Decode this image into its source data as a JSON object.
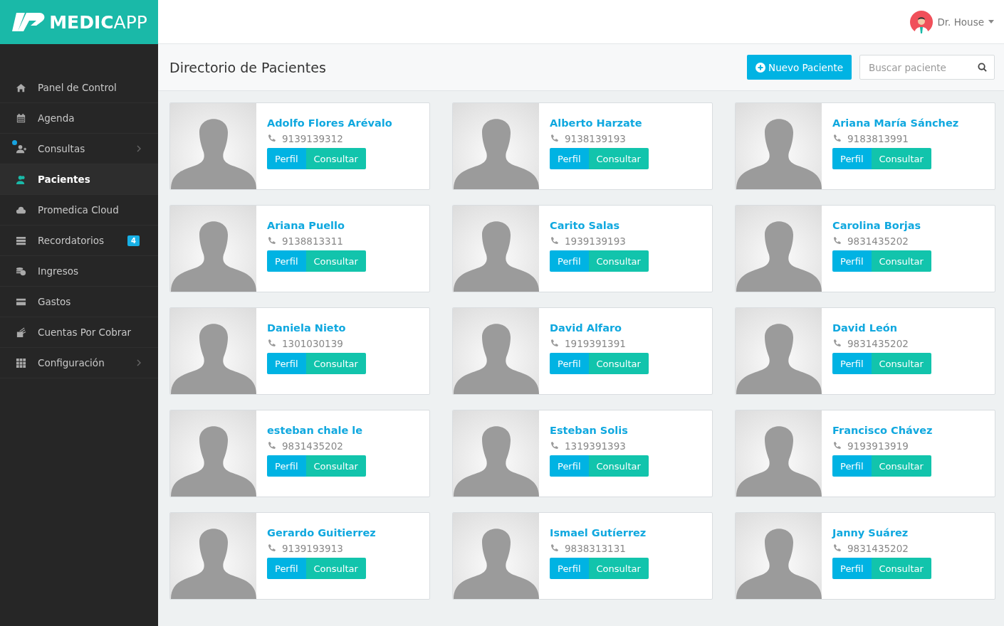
{
  "logo": {
    "bold": "MEDIC",
    "light": "APP"
  },
  "user": {
    "name": "Dr. House"
  },
  "sidebar": {
    "items": [
      {
        "label": "Panel de Control",
        "selected": false
      },
      {
        "label": "Agenda",
        "selected": false
      },
      {
        "label": "Consultas",
        "selected": false,
        "submenu": true,
        "dot": true
      },
      {
        "label": "Pacientes",
        "selected": true
      },
      {
        "label": "Promedica Cloud",
        "selected": false
      },
      {
        "label": "Recordatorios",
        "selected": false,
        "badge": "4"
      },
      {
        "label": "Ingresos",
        "selected": false
      },
      {
        "label": "Gastos",
        "selected": false
      },
      {
        "label": "Cuentas Por Cobrar",
        "selected": false
      },
      {
        "label": "Configuración",
        "selected": false,
        "submenu": true
      }
    ]
  },
  "page": {
    "title": "Directorio de Pacientes",
    "new_button": "Nuevo Paciente",
    "search": {
      "placeholder": "Buscar paciente"
    }
  },
  "patients": [
    {
      "name": "Adolfo Flores Arévalo",
      "phone": "9139139312",
      "profile": "Perfil",
      "consult": "Consultar"
    },
    {
      "name": "Alberto Harzate",
      "phone": "9138139193",
      "profile": "Perfil",
      "consult": "Consultar"
    },
    {
      "name": "Ariana María Sánchez",
      "phone": "9183813991",
      "profile": "Perfil",
      "consult": "Consultar"
    },
    {
      "name": "Ariana Puello",
      "phone": "9138813311",
      "profile": "Perfil",
      "consult": "Consultar"
    },
    {
      "name": "Carito Salas",
      "phone": "1939139193",
      "profile": "Perfil",
      "consult": "Consultar"
    },
    {
      "name": "Carolina Borjas",
      "phone": "9831435202",
      "profile": "Perfil",
      "consult": "Consultar"
    },
    {
      "name": "Daniela Nieto",
      "phone": "1301030139",
      "profile": "Perfil",
      "consult": "Consultar"
    },
    {
      "name": "David Alfaro",
      "phone": "1919391391",
      "profile": "Perfil",
      "consult": "Consultar"
    },
    {
      "name": "David León",
      "phone": "9831435202",
      "profile": "Perfil",
      "consult": "Consultar"
    },
    {
      "name": "esteban chale le",
      "phone": "9831435202",
      "profile": "Perfil",
      "consult": "Consultar"
    },
    {
      "name": "Esteban Solis",
      "phone": "1319391393",
      "profile": "Perfil",
      "consult": "Consultar"
    },
    {
      "name": "Francisco Chávez",
      "phone": "9193913919",
      "profile": "Perfil",
      "consult": "Consultar"
    },
    {
      "name": "Gerardo Guitierrez",
      "phone": "9139193913",
      "profile": "Perfil",
      "consult": "Consultar"
    },
    {
      "name": "Ismael Gutíerrez",
      "phone": "9838313131",
      "profile": "Perfil",
      "consult": "Consultar"
    },
    {
      "name": "Janny Suárez",
      "phone": "9831435202",
      "profile": "Perfil",
      "consult": "Consultar"
    }
  ]
}
